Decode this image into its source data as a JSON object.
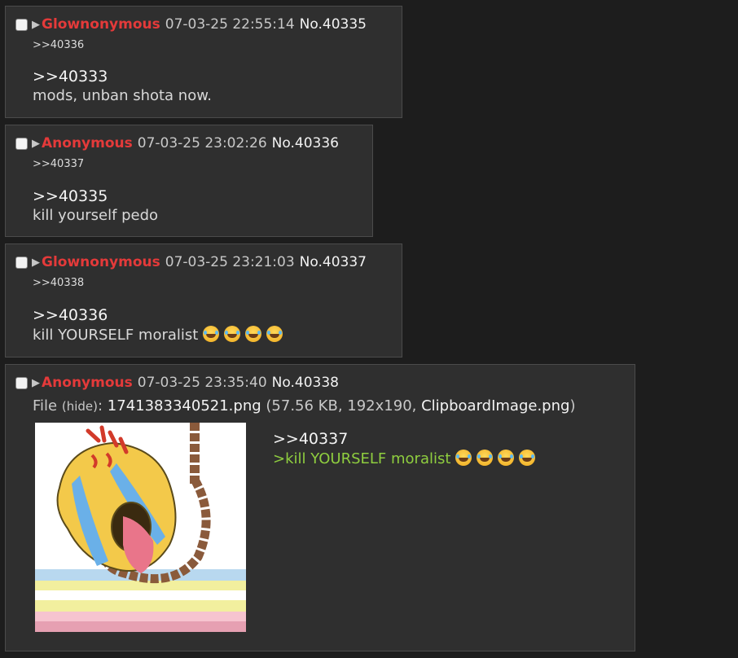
{
  "posts": [
    {
      "name": "Glownonymous",
      "datetime": "07-03-25 22:55:14",
      "number": "No.40335",
      "backlink": ">>40336",
      "quote": ">>40333",
      "message": "mods, unban shota now."
    },
    {
      "name": "Anonymous",
      "datetime": "07-03-25 23:02:26",
      "number": "No.40336",
      "backlink": ">>40337",
      "quote": ">>40335",
      "message": "kill yourself pedo"
    },
    {
      "name": "Glownonymous",
      "datetime": "07-03-25 23:21:03",
      "number": "No.40337",
      "backlink": ">>40338",
      "quote": ">>40336",
      "message": "kill YOURSELF moralist",
      "emoji_count": 4
    },
    {
      "name": "Anonymous",
      "datetime": "07-03-25 23:35:40",
      "number": "No.40338",
      "file": {
        "prefix": "File",
        "hide_label": "(hide)",
        "filename": "1741383340521.png",
        "size": "57.56 KB",
        "dimensions": "192x190",
        "original_name": "ClipboardImage.png"
      },
      "quote": ">>40337",
      "greentext": ">kill YOURSELF moralist",
      "emoji_count": 4
    }
  ],
  "colors": {
    "background": "#1d1d1d",
    "post_background": "#2f2f2f",
    "name_red": "#e43a3a",
    "greentext": "#8fce3f"
  },
  "icons": {
    "checkbox": "post-select-checkbox",
    "arrow": "post-menu-arrow",
    "emoji": "laughing-with-tears-emoji"
  }
}
